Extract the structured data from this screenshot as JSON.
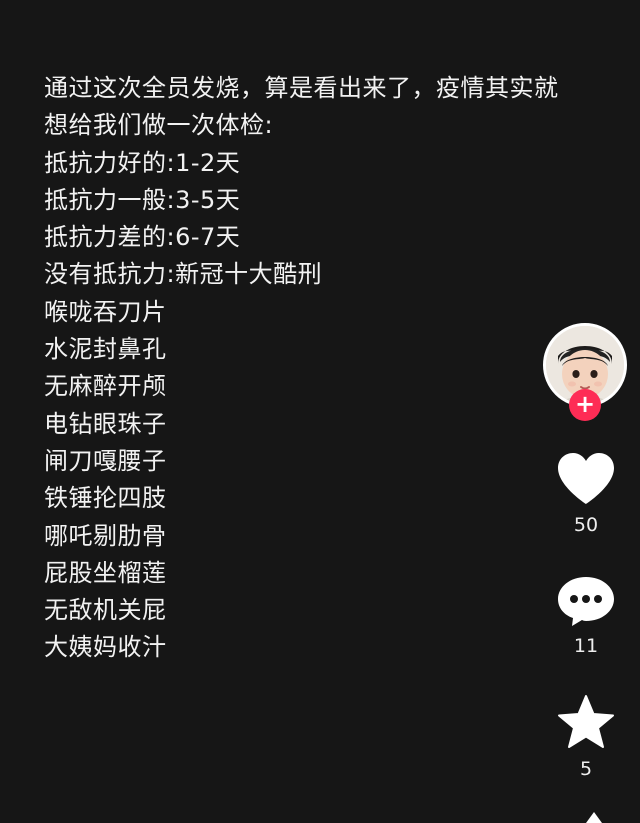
{
  "post": {
    "lines": [
      "通过这次全员发烧，算是看出来了，疫情其实就想给我们做一次体检:",
      "抵抗力好的:1-2天",
      "抵抗力一般:3-5天",
      "抵抗力差的:6-7天",
      "没有抵抗力:新冠十大酷刑",
      "喉咙吞刀片",
      "水泥封鼻孔",
      "无麻醉开颅",
      "电钻眼珠子",
      "闸刀嘎腰子",
      "铁锤抡四肢",
      "哪吒剔肋骨",
      "屁股坐榴莲",
      "无敌机关屁",
      "大姨妈收汁"
    ]
  },
  "sidebar": {
    "follow_label": "+",
    "like_count": "50",
    "comment_count": "11",
    "favorite_count": "5"
  },
  "icons": {
    "avatar": "child-avatar",
    "follow": "plus-icon",
    "like": "heart-icon",
    "comment": "comment-bubble-icon",
    "favorite": "star-icon",
    "share": "share-arrow-icon"
  },
  "colors": {
    "background": "#161616",
    "text": "#f2f2f2",
    "icon": "#ffffff",
    "follow_button": "#fe2c55"
  }
}
